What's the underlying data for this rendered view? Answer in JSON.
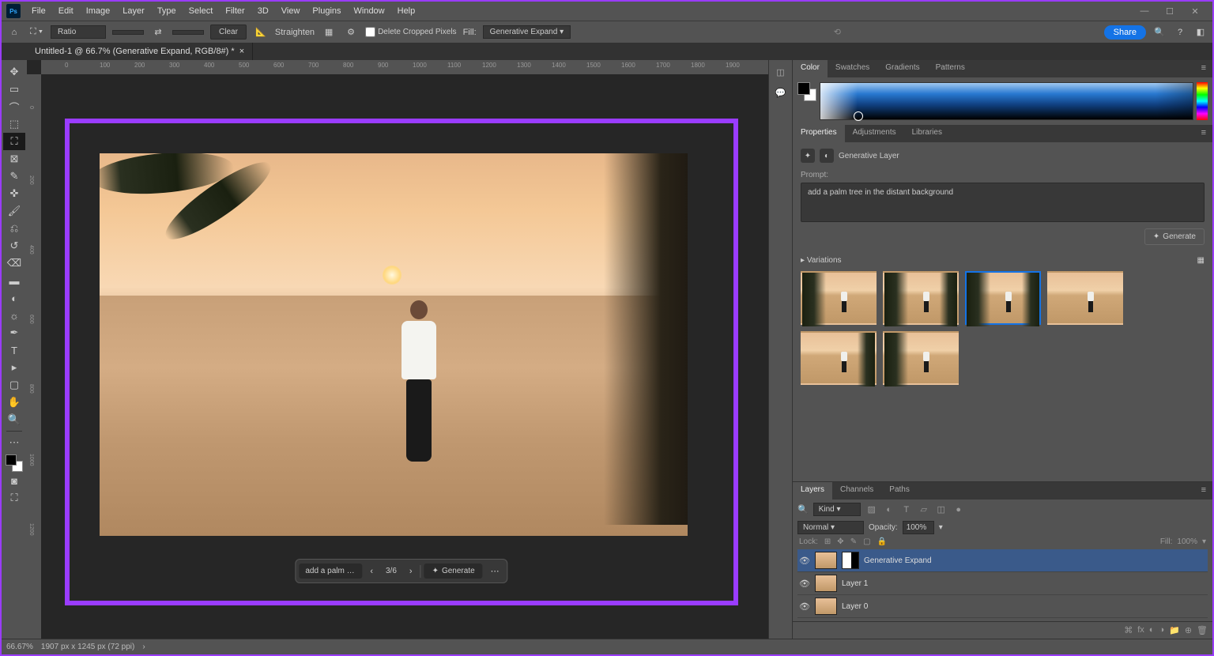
{
  "menu": [
    "File",
    "Edit",
    "Image",
    "Layer",
    "Type",
    "Select",
    "Filter",
    "3D",
    "View",
    "Plugins",
    "Window",
    "Help"
  ],
  "logo": "Ps",
  "optbar": {
    "ratio": "Ratio",
    "clear": "Clear",
    "straighten": "Straighten",
    "delete_cropped": "Delete Cropped Pixels",
    "fill_label": "Fill:",
    "fill_mode": "Generative Expand",
    "share": "Share"
  },
  "doctab": {
    "title": "Untitled-1 @ 66.7% (Generative Expand, RGB/8#) *"
  },
  "ruler_h": [
    "0",
    "100",
    "200",
    "300",
    "400",
    "500",
    "600",
    "700",
    "800",
    "900",
    "1000",
    "1100",
    "1200",
    "1300",
    "1400",
    "1500",
    "1600",
    "1700",
    "1800",
    "1900"
  ],
  "ruler_v": [
    "0",
    "200",
    "400",
    "600",
    "800",
    "1000",
    "1200"
  ],
  "taskbar": {
    "prompt": "add a palm tre...",
    "count": "3/6",
    "generate": "Generate"
  },
  "color_tabs": [
    "Color",
    "Swatches",
    "Gradients",
    "Patterns"
  ],
  "props_tabs": [
    "Properties",
    "Adjustments",
    "Libraries"
  ],
  "props": {
    "layer_type": "Generative Layer",
    "prompt_label": "Prompt:",
    "prompt_text": "add a palm tree in the distant background",
    "generate": "Generate",
    "variations": "Variations"
  },
  "variations": {
    "selected_index": 2,
    "items": [
      {
        "palms": "heavy-left"
      },
      {
        "palms": "both"
      },
      {
        "palms": "left-right"
      },
      {
        "palms": "none"
      },
      {
        "palms": "light-right"
      },
      {
        "palms": "medium"
      }
    ]
  },
  "layers_tabs": [
    "Layers",
    "Channels",
    "Paths"
  ],
  "layers": {
    "kind": "Kind",
    "blend": "Normal",
    "opacity_label": "Opacity:",
    "opacity": "100%",
    "lock_label": "Lock:",
    "fill_label": "Fill:",
    "fill": "100%",
    "items": [
      {
        "name": "Generative Expand",
        "mask": true,
        "active": true
      },
      {
        "name": "Layer 1",
        "mask": false,
        "active": false
      },
      {
        "name": "Layer 0",
        "mask": false,
        "active": false
      }
    ]
  },
  "status": {
    "zoom": "66.67%",
    "dims": "1907 px x 1245 px (72 ppi)"
  }
}
